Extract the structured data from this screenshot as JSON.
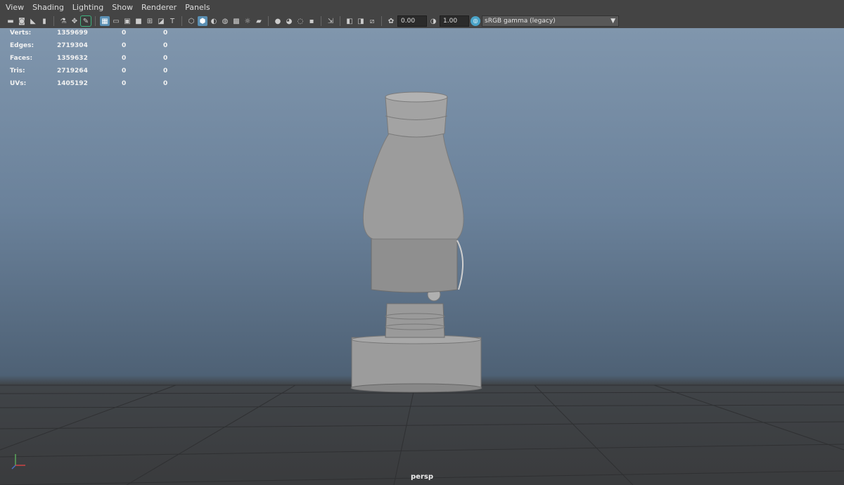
{
  "menu": {
    "items": [
      "View",
      "Shading",
      "Lighting",
      "Show",
      "Renderer",
      "Panels"
    ]
  },
  "toolbar": {
    "exposure_value": "0.00",
    "gamma_value": "1.00",
    "color_space": "sRGB gamma (legacy)",
    "icons": [
      "camera-select-icon",
      "camera-attributes-icon",
      "bookmark-icon",
      "image-plane-icon",
      "grid-icon",
      "film-gate-icon",
      "resolution-gate-icon",
      "safe-area-icon",
      "field-chart-icon",
      "wireframe-icon",
      "smooth-shade-icon",
      "default-material-icon",
      "textured-icon",
      "use-all-lights-icon",
      "shadows-icon",
      "ambient-occlusion-icon",
      "motion-blur-icon",
      "anti-alias-icon",
      "depth-of-field-icon",
      "isolate-select-icon",
      "xray-icon",
      "xray-joints-icon",
      "backface-culling-icon"
    ]
  },
  "hud": {
    "rows": [
      {
        "label": "Verts:",
        "value": "1359699",
        "sel": "0",
        "comp": "0"
      },
      {
        "label": "Edges:",
        "value": "2719304",
        "sel": "0",
        "comp": "0"
      },
      {
        "label": "Faces:",
        "value": "1359632",
        "sel": "0",
        "comp": "0"
      },
      {
        "label": "Tris:",
        "value": "2719264",
        "sel": "0",
        "comp": "0"
      },
      {
        "label": "UVs:",
        "value": "1405192",
        "sel": "0",
        "comp": "0"
      }
    ]
  },
  "camera_label": "persp",
  "colors": {
    "bg_top": "#8096ad",
    "bg_bottom": "#4e6175",
    "model_gray": "#9a9a9a",
    "active_icon": "#5a8fb3"
  }
}
